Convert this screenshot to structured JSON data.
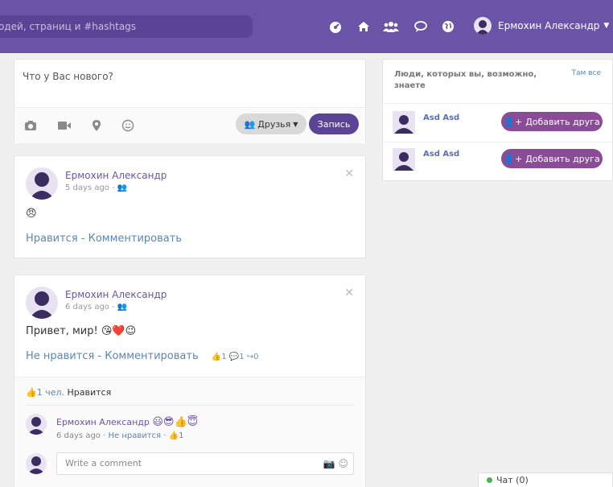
{
  "topbar": {
    "search_placeholder": "одей, страниц и #hashtags",
    "icons": [
      "dashboard-icon",
      "home-icon",
      "friends-icon",
      "messages-icon",
      "globe-icon"
    ],
    "user_name": "Ермохин Александр"
  },
  "composer": {
    "placeholder": "Что у Вас нового?",
    "tools": [
      "camera-icon",
      "video-icon",
      "location-icon",
      "smile-icon"
    ],
    "privacy_label": "Друзья",
    "post_button": "Запись"
  },
  "posts": [
    {
      "author": "Ермохин Александр",
      "meta": "5 days ago -",
      "body": "😠",
      "actions": "Нравится - Комментировать"
    },
    {
      "author": "Ермохин Александр",
      "meta": "6 days ago -",
      "body": "Привет, мир! 😘❤️😉",
      "actions": "Не нравится - Комментировать",
      "counts": "👍1 💬1 ↪0",
      "likes_link": "1 чел.",
      "likes_text": " Нравится",
      "comment_author": "Ермохин Александр",
      "comment_emojis": "😃😎👍😇",
      "comment_time": "6 days ago ·",
      "comment_unlike": "Не нравится",
      "comment_likes": "· 👍1",
      "write_placeholder": "Write a comment"
    }
  ],
  "suggestions": {
    "title": "Люди, которых вы, возможно, знаете",
    "see_all": "Там все",
    "people": [
      {
        "name": "Asd Asd",
        "button": "Добавить друга"
      },
      {
        "name": "Asd Asd",
        "button": "Добавить друга"
      }
    ]
  },
  "chat": {
    "label": "Чат (0)"
  },
  "colors": {
    "brand": "#6a54a8",
    "add_button": "#8a4b97",
    "link": "#5a87b5"
  }
}
